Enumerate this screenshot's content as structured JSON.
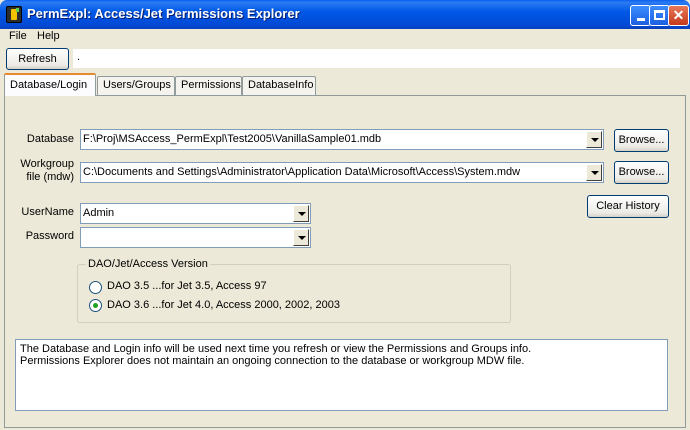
{
  "window": {
    "title": "PermExpl: Access/Jet Permissions Explorer",
    "minimize_label": "",
    "maximize_label": "",
    "close_label": "✕"
  },
  "menu": [
    {
      "label": "File"
    },
    {
      "label": "Help"
    }
  ],
  "toolbar": {
    "refresh_label": "Refresh",
    "status_text": "."
  },
  "tabs": [
    {
      "label": "Database/Login",
      "active": true
    },
    {
      "label": "Users/Groups",
      "active": false
    },
    {
      "label": "Permissions",
      "active": false
    },
    {
      "label": "DatabaseInfo",
      "active": false
    }
  ],
  "form": {
    "database_label": "Database",
    "database_value": "F:\\Proj\\MSAccess_PermExpl\\Test2005\\VanillaSample01.mdb",
    "workgroup_label_line1": "Workgroup",
    "workgroup_label_line2": "file (mdw)",
    "workgroup_value": "C:\\Documents and Settings\\Administrator\\Application Data\\Microsoft\\Access\\System.mdw",
    "username_label": "UserName",
    "username_value": "Admin",
    "password_label": "Password",
    "password_value": "",
    "browse_label": "Browse...",
    "clear_history_label": "Clear History"
  },
  "version_group": {
    "title": "DAO/Jet/Access Version",
    "options": [
      {
        "label": "DAO 3.5   ...for Jet 3.5,  Access 97",
        "checked": false
      },
      {
        "label": "DAO 3.6   ...for Jet 4.0,  Access 2000, 2002, 2003",
        "checked": true
      }
    ]
  },
  "info": {
    "line1": "The Database and Login info will be used next time you refresh or view the  Permissions and Groups info.",
    "line2": "Permissions Explorer does not maintain an ongoing  connection to the database or workgroup MDW file."
  }
}
